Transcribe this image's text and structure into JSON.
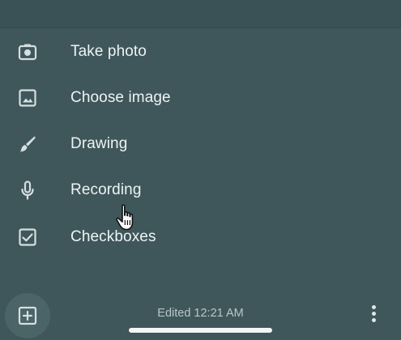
{
  "menu": {
    "items": [
      {
        "label": "Take photo",
        "icon": "camera-icon"
      },
      {
        "label": "Choose image",
        "icon": "image-icon"
      },
      {
        "label": "Drawing",
        "icon": "brush-icon"
      },
      {
        "label": "Recording",
        "icon": "microphone-icon"
      },
      {
        "label": "Checkboxes",
        "icon": "checkbox-icon"
      }
    ]
  },
  "footer": {
    "add_icon": "add-box-icon",
    "edited_label": "Edited 12:21 AM",
    "more_icon": "more-vertical-icon"
  },
  "cursor": {
    "icon": "hand-pointer-icon"
  },
  "colors": {
    "background": "#3f575b",
    "text": "#eef3f4",
    "muted_text": "#b8c6c8",
    "icon": "#d6dfe0"
  }
}
